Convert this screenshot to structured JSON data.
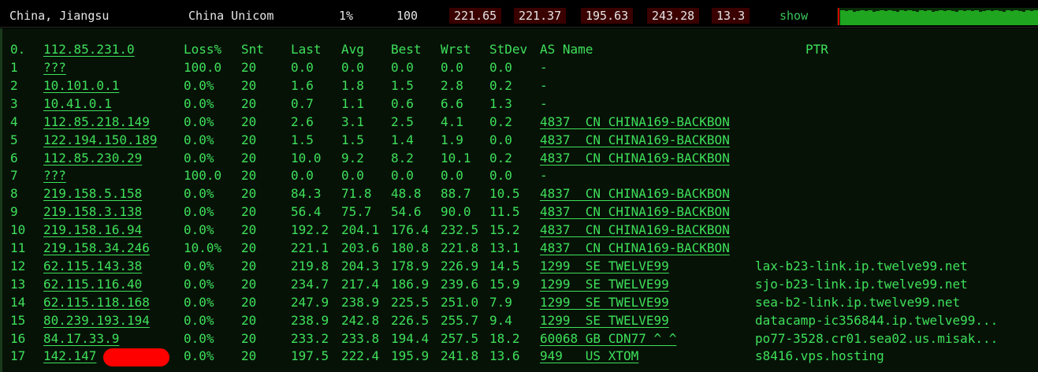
{
  "summary": {
    "location": "China, Jiangsu",
    "isp": "China Unicom",
    "loss": "1%",
    "sent": "100",
    "last": "221.65",
    "avg": "221.37",
    "best": "195.63",
    "worst": "243.28",
    "stdev": "13.3",
    "show_label": "show"
  },
  "headers": {
    "hop": "0.",
    "host": "112.85.231.0",
    "loss": "Loss%",
    "snt": "Snt",
    "last": "Last",
    "avg": "Avg",
    "best": "Best",
    "wrst": "Wrst",
    "stdev": "StDev",
    "asname": "AS Name",
    "ptr": "PTR"
  },
  "rows": [
    {
      "hop": "1",
      "host": "???",
      "loss": "100.0",
      "snt": "20",
      "last": "0.0",
      "avg": "0.0",
      "best": "0.0",
      "wrst": "0.0",
      "stdev": "0.0",
      "as": "-",
      "ptr": ""
    },
    {
      "hop": "2",
      "host": "10.101.0.1",
      "loss": "0.0%",
      "snt": "20",
      "last": "1.6",
      "avg": "1.8",
      "best": "1.5",
      "wrst": "2.8",
      "stdev": "0.2",
      "as": "-",
      "ptr": ""
    },
    {
      "hop": "3",
      "host": "10.41.0.1",
      "loss": "0.0%",
      "snt": "20",
      "last": "0.7",
      "avg": "1.1",
      "best": "0.6",
      "wrst": "6.6",
      "stdev": "1.3",
      "as": "-",
      "ptr": ""
    },
    {
      "hop": "4",
      "host": "112.85.218.149",
      "loss": "0.0%",
      "snt": "20",
      "last": "2.6",
      "avg": "3.1",
      "best": "2.5",
      "wrst": "4.1",
      "stdev": "0.2",
      "as": "4837  CN CHINA169-BACKBON",
      "ptr": ""
    },
    {
      "hop": "5",
      "host": "122.194.150.189",
      "loss": "0.0%",
      "snt": "20",
      "last": "1.5",
      "avg": "1.5",
      "best": "1.4",
      "wrst": "1.9",
      "stdev": "0.0",
      "as": "4837  CN CHINA169-BACKBON",
      "ptr": ""
    },
    {
      "hop": "6",
      "host": "112.85.230.29",
      "loss": "0.0%",
      "snt": "20",
      "last": "10.0",
      "avg": "9.2",
      "best": "8.2",
      "wrst": "10.1",
      "stdev": "0.2",
      "as": "4837  CN CHINA169-BACKBON",
      "ptr": ""
    },
    {
      "hop": "7",
      "host": "???",
      "loss": "100.0",
      "snt": "20",
      "last": "0.0",
      "avg": "0.0",
      "best": "0.0",
      "wrst": "0.0",
      "stdev": "0.0",
      "as": "-",
      "ptr": ""
    },
    {
      "hop": "8",
      "host": "219.158.5.158",
      "loss": "0.0%",
      "snt": "20",
      "last": "84.3",
      "avg": "71.8",
      "best": "48.8",
      "wrst": "88.7",
      "stdev": "10.5",
      "as": "4837  CN CHINA169-BACKBON",
      "ptr": ""
    },
    {
      "hop": "9",
      "host": "219.158.3.138",
      "loss": "0.0%",
      "snt": "20",
      "last": "56.4",
      "avg": "75.7",
      "best": "54.6",
      "wrst": "90.0",
      "stdev": "11.5",
      "as": "4837  CN CHINA169-BACKBON",
      "ptr": ""
    },
    {
      "hop": "10",
      "host": "219.158.16.94",
      "loss": "0.0%",
      "snt": "20",
      "last": "192.2",
      "avg": "204.1",
      "best": "176.4",
      "wrst": "232.5",
      "stdev": "15.2",
      "as": "4837  CN CHINA169-BACKBON",
      "ptr": ""
    },
    {
      "hop": "11",
      "host": "219.158.34.246",
      "loss": "10.0%",
      "snt": "20",
      "last": "221.1",
      "avg": "203.6",
      "best": "180.8",
      "wrst": "221.8",
      "stdev": "13.1",
      "as": "4837  CN CHINA169-BACKBON",
      "ptr": ""
    },
    {
      "hop": "12",
      "host": "62.115.143.38",
      "loss": "0.0%",
      "snt": "20",
      "last": "219.8",
      "avg": "204.3",
      "best": "178.9",
      "wrst": "226.9",
      "stdev": "14.5",
      "as": "1299  SE TWELVE99",
      "ptr": "lax-b23-link.ip.twelve99.net"
    },
    {
      "hop": "13",
      "host": "62.115.116.40",
      "loss": "0.0%",
      "snt": "20",
      "last": "234.7",
      "avg": "217.4",
      "best": "186.9",
      "wrst": "239.6",
      "stdev": "15.9",
      "as": "1299  SE TWELVE99",
      "ptr": "sjo-b23-link.ip.twelve99.net"
    },
    {
      "hop": "14",
      "host": "62.115.118.168",
      "loss": "0.0%",
      "snt": "20",
      "last": "247.9",
      "avg": "238.9",
      "best": "225.5",
      "wrst": "251.0",
      "stdev": "7.9",
      "as": "1299  SE TWELVE99",
      "ptr": "sea-b2-link.ip.twelve99.net"
    },
    {
      "hop": "15",
      "host": "80.239.193.194",
      "loss": "0.0%",
      "snt": "20",
      "last": "238.9",
      "avg": "242.8",
      "best": "226.5",
      "wrst": "255.7",
      "stdev": "9.4",
      "as": "1299  SE TWELVE99",
      "ptr": "datacamp-ic356844.ip.twelve99..."
    },
    {
      "hop": "16",
      "host": "84.17.33.9",
      "loss": "0.0%",
      "snt": "20",
      "last": "233.2",
      "avg": "233.8",
      "best": "194.4",
      "wrst": "257.5",
      "stdev": "18.2",
      "as": "60068 GB CDN77 ^_^",
      "ptr": "po77-3528.cr01.sea02.us.misak..."
    },
    {
      "hop": "17",
      "host": "142.147",
      "loss": "0.0%",
      "snt": "20",
      "last": "197.5",
      "avg": "222.4",
      "best": "195.9",
      "wrst": "241.8",
      "stdev": "13.6",
      "as": "949   US XTOM",
      "ptr": "s8416.vps.hosting",
      "redacted": true
    }
  ],
  "sparkline": [
    19,
    18,
    19,
    17,
    18,
    19,
    18,
    19,
    17,
    18,
    19,
    18,
    19,
    18,
    17,
    19,
    18,
    19,
    18,
    17,
    19,
    18,
    19,
    17,
    18,
    19,
    18,
    19,
    18,
    17,
    19,
    18,
    19,
    18,
    19,
    17,
    18,
    19,
    18,
    19,
    18,
    17,
    19,
    18,
    19,
    18,
    17,
    19,
    18,
    19
  ],
  "colors": {
    "text_green": "#3ee05a",
    "panel_bg": "#071207",
    "redaction": "#ff0000"
  }
}
